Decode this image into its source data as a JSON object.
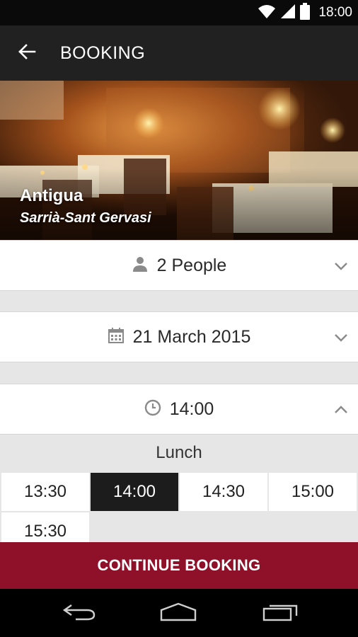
{
  "status_bar": {
    "time": "18:00",
    "icons": [
      "wifi-icon",
      "signal-icon",
      "battery-icon"
    ]
  },
  "app_bar": {
    "title": "BOOKING",
    "back_icon": "arrow-left-icon"
  },
  "restaurant": {
    "name": "Antigua",
    "area": "Sarrià-Sant Gervasi"
  },
  "party": {
    "label": "2 People",
    "icon": "person-icon"
  },
  "date": {
    "label": "21 March 2015",
    "icon": "calendar-icon"
  },
  "time_select": {
    "label": "14:00",
    "icon": "clock-icon",
    "expanded": true
  },
  "lunch": {
    "label": "Lunch",
    "slots": [
      "13:30",
      "14:00",
      "14:30",
      "15:00",
      "15:30"
    ],
    "selected": "14:00"
  },
  "continue_label": "CONTINUE BOOKING",
  "colors": {
    "accent": "#8e1129",
    "app_bar": "#212121",
    "selected_slot": "#1c1c1c"
  },
  "nav_bar": {
    "icons": [
      "back-nav-icon",
      "home-nav-icon",
      "recents-nav-icon"
    ]
  }
}
